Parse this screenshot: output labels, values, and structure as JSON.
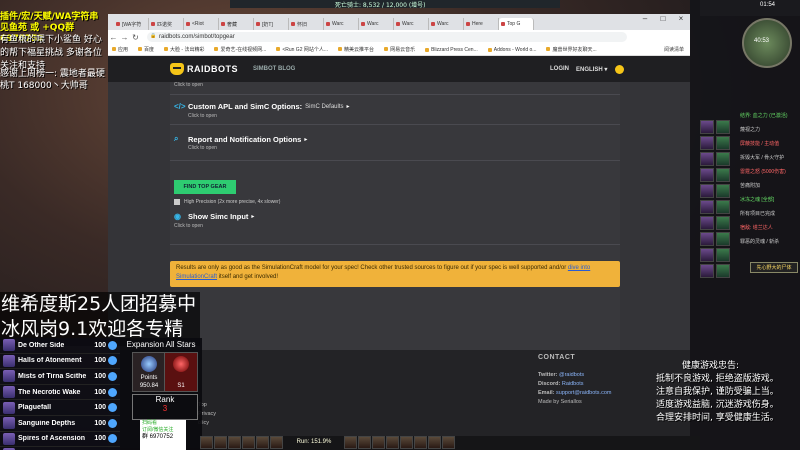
{
  "game": {
    "top_text": "死亡骑士: 8,532 / 12,000 (增号)",
    "overlay_top": "插件/宏/天赋/WA字符串 见鱼苑 或 +QQ群6970752",
    "overlay_mid": "有鱼粮的喂下小鲨鱼 好心的帮下福星挑战 多谢各位关注和支持",
    "overlay_low": "感谢上周榜一: 震地者最硬桃T 168000丶大帅哥",
    "recruit_1": "维希度斯25人团招募中",
    "recruit_2": "冰风岗9.1欢迎各专精",
    "dungeons": [
      {
        "name": "De Other Side",
        "level": "100"
      },
      {
        "name": "Halls of Atonement",
        "level": "100"
      },
      {
        "name": "Mists of Tirna Scithe",
        "level": "100"
      },
      {
        "name": "The Necrotic Wake",
        "level": "100"
      },
      {
        "name": "Plaguefall",
        "level": "100"
      },
      {
        "name": "Sanguine Depths",
        "level": "100"
      },
      {
        "name": "Spires of Ascension",
        "level": "100"
      },
      {
        "name": "Theater of Pain",
        "level": "100"
      }
    ],
    "expansion": {
      "title": "Expansion All Stars",
      "points_label": "Points",
      "points_value": "950.84",
      "season_label": "S1",
      "rank_label": "Rank",
      "rank_value": "3"
    },
    "qr": {
      "line1": "扫码看",
      "line2": "订阅/微信关注",
      "qq": "群 6970752"
    },
    "minimap_text": "40:53",
    "clock": "01:54",
    "right_lines": [
      {
        "text": "结界: 血之力 (已激活)",
        "tone": "g"
      },
      {
        "text": "蔑视之力",
        "tone": ""
      },
      {
        "text": "屏蔽技能 / 主动值",
        "tone": "r"
      },
      {
        "text": "拆毁大军 / 骨火守护",
        "tone": ""
      },
      {
        "text": "雷霆之怒 (5000伤害)",
        "tone": "r"
      },
      {
        "text": "苦痛附加",
        "tone": ""
      },
      {
        "text": "冰冻之魂 [全部]",
        "tone": "g"
      },
      {
        "text": "所有项目已完成",
        "tone": ""
      },
      {
        "text": "宿敌: 塔兰达人",
        "tone": "r"
      },
      {
        "text": "罪恶的灵魂 / 斩杀",
        "tone": ""
      }
    ],
    "right_button": "先心野大的尸体",
    "health": {
      "title": "健康游戏忠告:",
      "lines": [
        "抵制不良游戏, 拒绝盗版游戏。",
        "注意自我保护, 谨防受骗上当。",
        "适度游戏益脑, 沉迷游戏伤身。",
        "合理安排时间, 享受健康生活。"
      ]
    },
    "run_text": "Run: 151.9%"
  },
  "browser": {
    "tabs": [
      "[WA字符",
      "匹诺奖",
      "<Riot",
      "奢藏",
      "[奶T]",
      "怀旧",
      "Warc",
      "Warc",
      "Warc",
      "Warc",
      "Here",
      "Top G"
    ],
    "active_tab_index": 11,
    "url": "raidbots.com/simbot/topgear",
    "bookmarks": [
      "应用",
      "百度",
      "大脸 - 法出精彩",
      "爱奇艺-在线视频网...",
      "<Run G2 网站个人...",
      "精美云推平台",
      "网易云音乐",
      "Blizzard Press Cen...",
      "Addons - World o...",
      "魔兽世界好友聊天..."
    ],
    "bookmark_right": "阅读清单"
  },
  "raidbots": {
    "logo": "RAIDBOTS",
    "nav_simbot": "SIMBOT",
    "nav_blog": "BLOG",
    "login": "LOGIN",
    "language": "ENGLISH ▾",
    "click_tip": "Click to open",
    "custom_apl_title": "Custom APL and SimC Options:",
    "custom_apl_sub": "SimC Defaults",
    "report_title": "Report and Notification Options",
    "find_button": "FIND TOP GEAR",
    "high_precision": "High Precision (2x more precise, 4x slower)",
    "show_simc": "Show Simc Input",
    "warning_text": "Results are only as good as the SimulationCraft model for your spec! Check other trusted sources to figure out if your spec is well supported and/or",
    "warning_link": "dive into SimulationCraft",
    "warning_tail": "itself and get involved!",
    "footer_contact": "CONTACT",
    "footer_twitter": "Twitter:",
    "footer_twitter_val": "@raidbots",
    "footer_discord": "Discord:",
    "footer_discord_val": "Raidbots",
    "footer_email": "Email:",
    "footer_email_val": "support@raidbots.com",
    "footer_made": "Made by Seriallos",
    "footer_left_1": "Top",
    "footer_left_2": "Privacy",
    "footer_left_3": "olicy"
  }
}
